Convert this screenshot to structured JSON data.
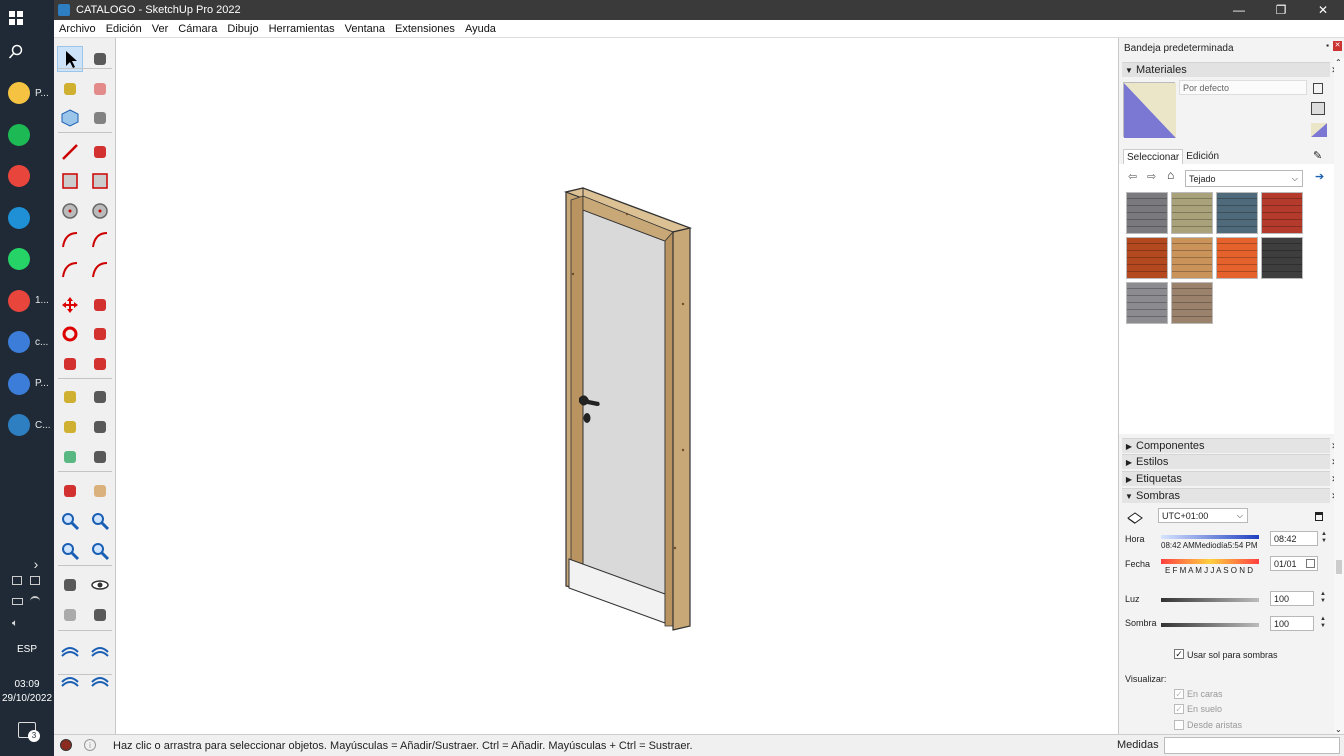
{
  "taskbar": {
    "apps": [
      {
        "label": "P...",
        "name": "file-explorer-icon",
        "color": "#f5c242"
      },
      {
        "label": "",
        "name": "spotify-icon",
        "color": "#1db954"
      },
      {
        "label": "",
        "name": "chrome-icon",
        "color": "#e8453c"
      },
      {
        "label": "",
        "name": "edge-icon",
        "color": "#1f8fd6"
      },
      {
        "label": "",
        "name": "whatsapp-icon",
        "color": "#25d366"
      },
      {
        "label": "1...",
        "name": "chrome-profile-icon",
        "color": "#e8453c"
      },
      {
        "label": "c...",
        "name": "sketchup-layout-icon",
        "color": "#3b7dd8"
      },
      {
        "label": "P...",
        "name": "sketchup-layout-icon-2",
        "color": "#3b7dd8"
      },
      {
        "label": "C...",
        "name": "sketchup-icon",
        "color": "#2d7fc1"
      }
    ],
    "language": "ESP",
    "time": "03:09",
    "date": "29/10/2022"
  },
  "window": {
    "title": "CATALOGO - SketchUp Pro 2022",
    "controls": [
      "—",
      "❐",
      "✕"
    ]
  },
  "menu": [
    "Archivo",
    "Edición",
    "Ver",
    "Cámara",
    "Dibujo",
    "Herramientas",
    "Ventana",
    "Extensiones",
    "Ayuda"
  ],
  "tray": {
    "title": "Bandeja predeterminada",
    "materials": {
      "header": "Materiales",
      "name_value": "Por defecto",
      "tabs": [
        "Seleccionar",
        "Edición"
      ],
      "library": "Tejado",
      "swatch_colors": [
        "#7a7a7e",
        "#a9a17a",
        "#4f6a7a",
        "#b43a2c",
        "#b4481f",
        "#c9935a",
        "#e5622c",
        "#3e3e3e",
        "#8b8b90",
        "#9b826c"
      ]
    },
    "panels": [
      "Componentes",
      "Estilos",
      "Etiquetas",
      "Sombras"
    ],
    "shadows": {
      "timezone": "UTC+01:00",
      "hora_label": "Hora",
      "hora_ticks": "08:42 AMMediodía5:54 PM",
      "hora_value": "08:42",
      "fecha_label": "Fecha",
      "fecha_ticks": "E F M A M J J A S O N D",
      "fecha_value": "01/01",
      "luz_label": "Luz",
      "luz_value": "100",
      "sombra_label": "Sombra",
      "sombra_value": "100",
      "use_sun_label": "Usar sol para sombras",
      "visualizar_label": "Visualizar:",
      "en_caras_label": "En caras",
      "en_suelo_label": "En suelo",
      "desde_aristas_label": "Desde aristas"
    }
  },
  "status": {
    "message": "Haz clic o arrastra para seleccionar objetos. Mayúsculas = Añadir/Sustraer. Ctrl = Añadir. Mayúsculas + Ctrl = Sustraer.",
    "measures_label": "Medidas"
  },
  "colors": {
    "wood": "#c9a877",
    "wood_dark": "#a9865a",
    "door_panel": "#d9d9d9",
    "accent_blue": "#cde3f7"
  }
}
